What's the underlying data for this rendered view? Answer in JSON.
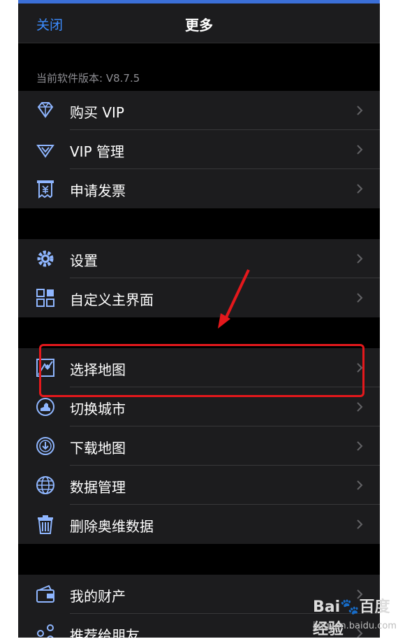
{
  "nav": {
    "close_label": "关闭",
    "title": "更多"
  },
  "version_text": "当前软件版本: V8.7.5",
  "groups": [
    {
      "items": [
        {
          "label": "购买 VIP",
          "icon": "diamond-icon"
        },
        {
          "label": "VIP 管理",
          "icon": "vip-diamond-icon"
        },
        {
          "label": "申请发票",
          "icon": "invoice-icon"
        }
      ]
    },
    {
      "items": [
        {
          "label": "设置",
          "icon": "gear-icon"
        },
        {
          "label": "自定义主界面",
          "icon": "grid-icon"
        }
      ]
    },
    {
      "items": [
        {
          "label": "选择地图",
          "icon": "map-icon"
        },
        {
          "label": "切换城市",
          "icon": "city-icon"
        },
        {
          "label": "下载地图",
          "icon": "download-icon"
        },
        {
          "label": "数据管理",
          "icon": "globe-icon"
        },
        {
          "label": "删除奥维数据",
          "icon": "trash-icon"
        }
      ]
    },
    {
      "items": [
        {
          "label": "我的财产",
          "icon": "wallet-icon"
        },
        {
          "label": "推荐给朋友",
          "icon": "share-icon"
        }
      ]
    }
  ],
  "watermark": {
    "logo": "Bai🐾百度经验",
    "url": "jingyan.baidu.com"
  },
  "colors": {
    "accent": "#3c8cff",
    "highlight": "#e4181c",
    "background": "#000000",
    "cell": "#1c1c1e"
  }
}
